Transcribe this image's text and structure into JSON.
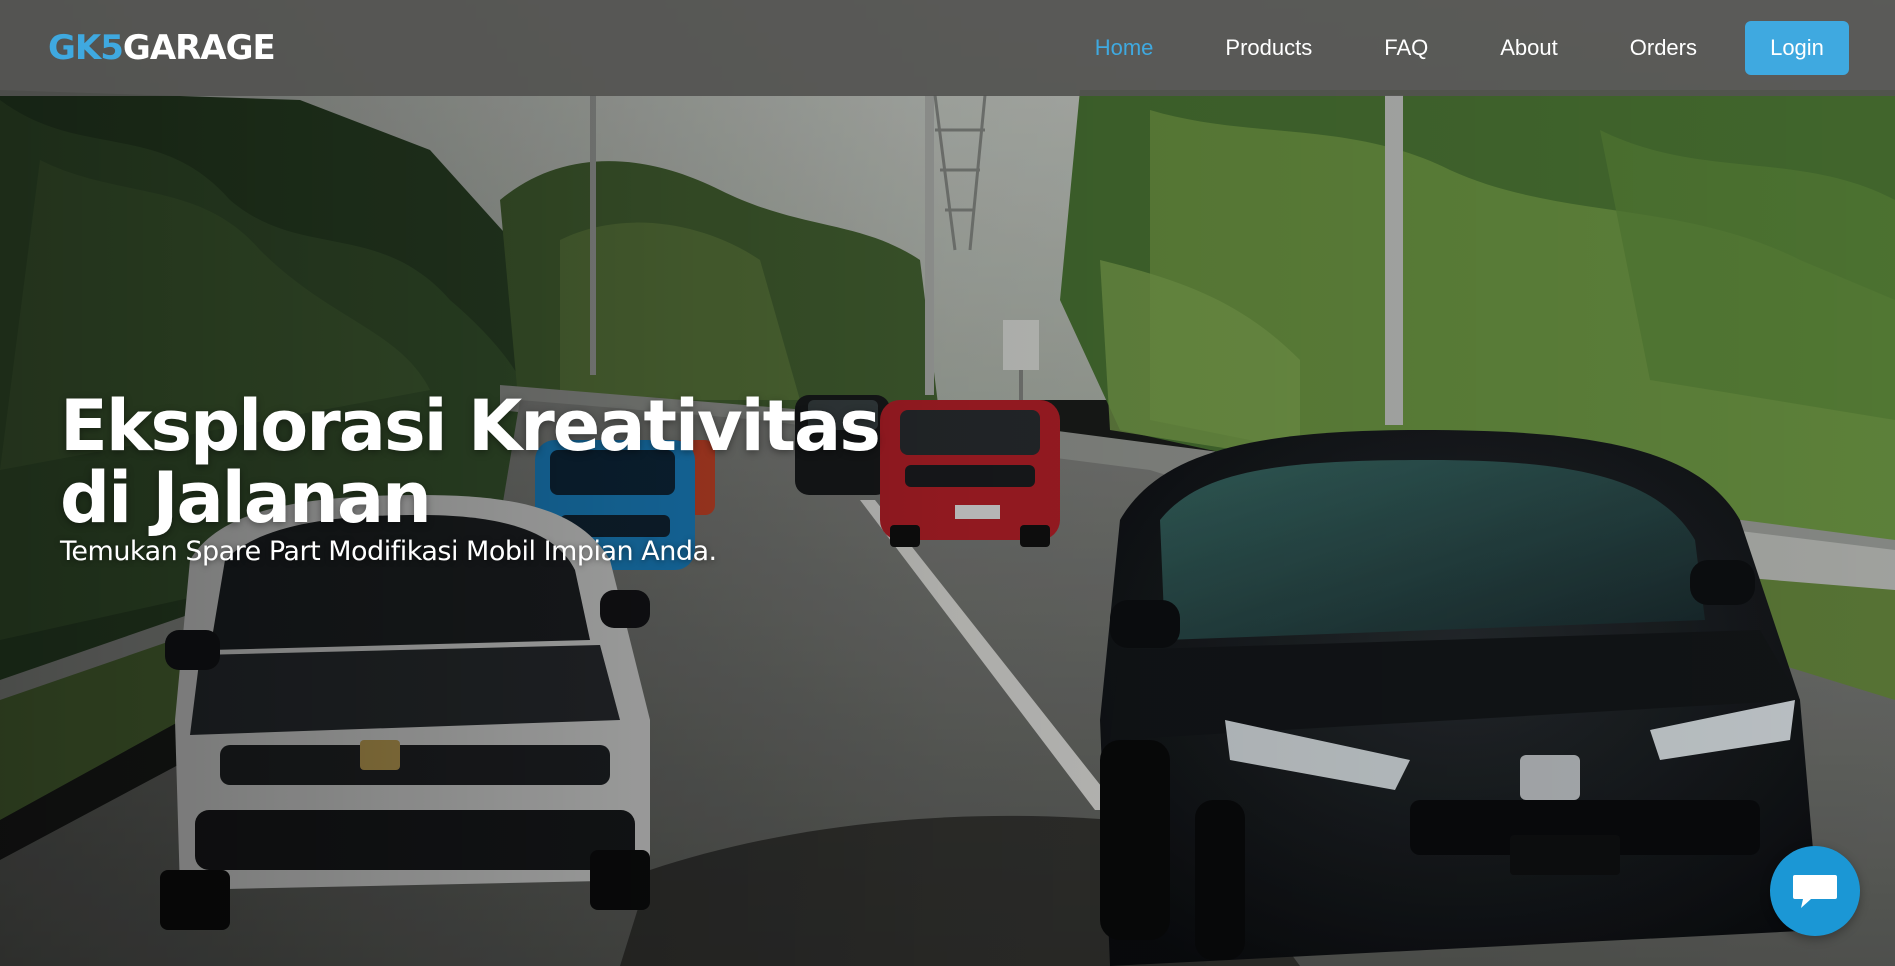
{
  "brand": {
    "part1": "GK5",
    "part2": "GARAGE"
  },
  "nav": {
    "items": [
      {
        "label": "Home",
        "active": true
      },
      {
        "label": "Products",
        "active": false
      },
      {
        "label": "FAQ",
        "active": false
      },
      {
        "label": "About",
        "active": false
      },
      {
        "label": "Orders",
        "active": false
      }
    ],
    "login_label": "Login"
  },
  "hero": {
    "title": "Eksplorasi Kreativitas di Jalanan",
    "subtitle": "Temukan Spare Part Modifikasi Mobil Impian Anda.",
    "image_description_icon": "hero-photo"
  },
  "chat": {
    "icon": "chat-bubble-icon"
  },
  "colors": {
    "accent": "#3fa9e0",
    "navbar": "#525250",
    "chat": "#1b97d5"
  }
}
